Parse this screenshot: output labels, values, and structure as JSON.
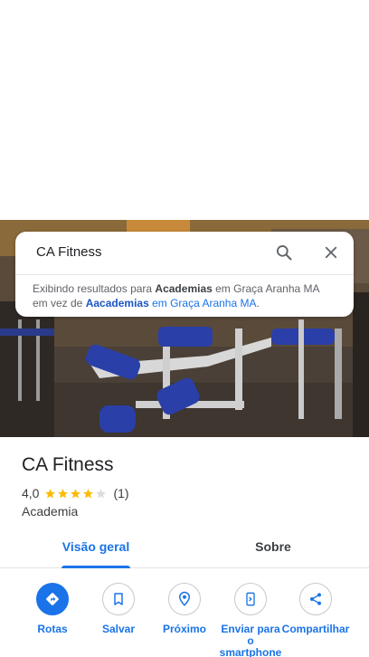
{
  "search": {
    "query": "CA Fitness",
    "spell_prefix": "Exibindo resultados para ",
    "shown_term": "Academias",
    "shown_location": " em Graça Aranha MA",
    "instead_prefix": "em vez de ",
    "original_term": "Aacademias",
    "original_location": " em Graça Aranha MA",
    "period": "."
  },
  "place": {
    "name": "CA Fitness",
    "rating": "4,0",
    "rating_value": 4.0,
    "rating_max": 5,
    "review_count": "(1)",
    "category": "Academia"
  },
  "tabs": [
    {
      "label": "Visão geral",
      "active": true
    },
    {
      "label": "Sobre",
      "active": false
    }
  ],
  "actions": {
    "directions": "Rotas",
    "save": "Salvar",
    "nearby": "Próximo",
    "send_to_phone": "Enviar para o smartphone",
    "share": "Compartilhar"
  },
  "colors": {
    "accent": "#1a73e8",
    "star": "#fbbc04",
    "star_empty": "#dadce0"
  },
  "icons": {
    "search": "search-icon",
    "close": "close-icon",
    "directions": "directions-icon",
    "save": "bookmark-icon",
    "nearby": "nearby-icon",
    "send": "send-to-phone-icon",
    "share": "share-icon"
  }
}
